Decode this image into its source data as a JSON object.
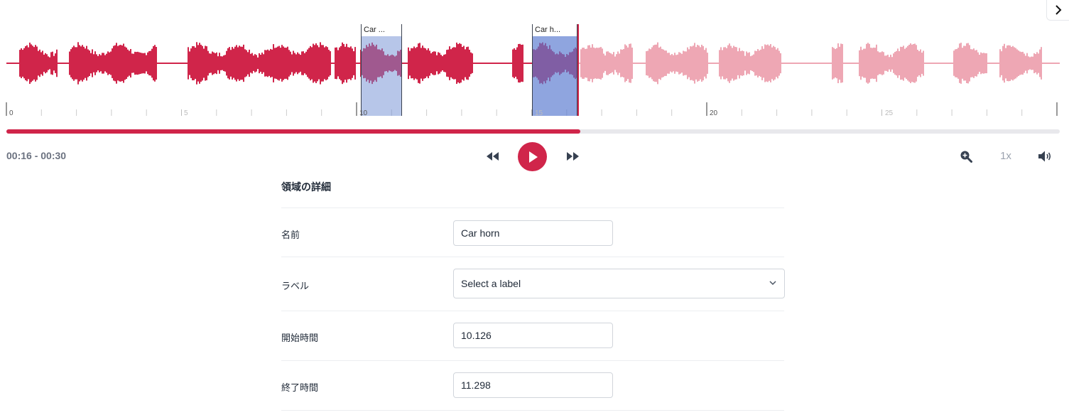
{
  "player": {
    "time_range": "00:16 - 00:30",
    "speed": "1x",
    "progress_fraction": 0.545,
    "accent_color": "#d0254a",
    "region_color": "#7f9ad6",
    "icons": {
      "rewind": "rewind-icon",
      "play": "play-icon",
      "forward": "fast-forward-icon",
      "zoom": "zoom-in-icon",
      "volume": "volume-icon",
      "sidebar_toggle": "chevron-right-icon"
    }
  },
  "timeline": {
    "tick_labels": [
      "0",
      "5",
      "10",
      "15",
      "20",
      "25"
    ],
    "regions": [
      {
        "label": "Car ..."
      },
      {
        "label": "Car h..."
      }
    ]
  },
  "details": {
    "title": "領域の詳細",
    "name_label": "名前",
    "name_value": "Car horn",
    "label_label": "ラベル",
    "label_placeholder": "Select a label",
    "start_label": "開始時間",
    "start_value": "10.126",
    "end_label": "終了時間",
    "end_value": "11.298"
  }
}
